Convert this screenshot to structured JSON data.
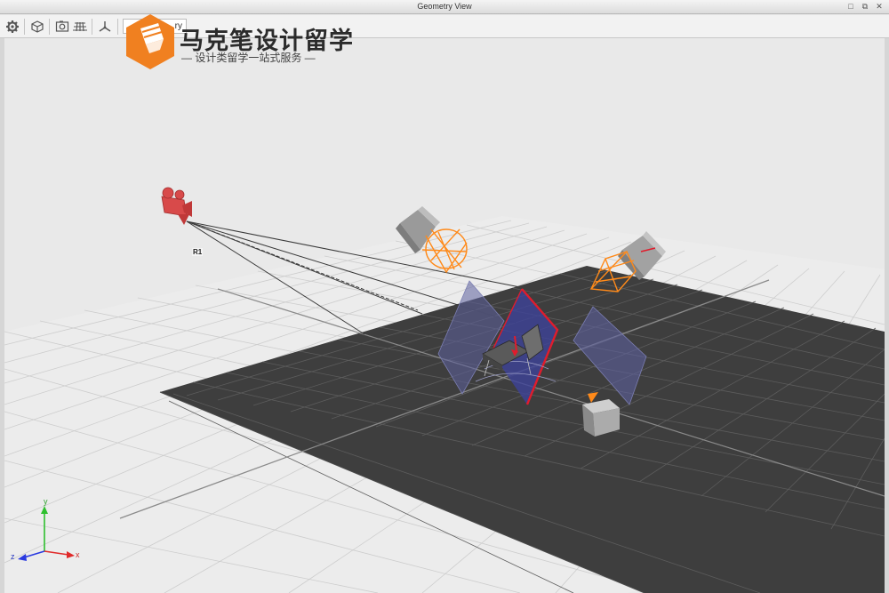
{
  "window": {
    "title": "Geometry View",
    "buttons": [
      "□",
      "⧉",
      "✕"
    ]
  },
  "toolbar": {
    "tools": [
      "settings-icon",
      "cube-icon",
      "screenshot-icon",
      "grid-icon",
      "axes-icon",
      "dropdown"
    ],
    "hidden_text": "ry"
  },
  "watermark": {
    "title": "马克笔设计留学",
    "subtitle": "— 设计类留学一站式服务 —",
    "brand_color": "#f08020"
  },
  "scene": {
    "camera_label": "R1",
    "axis_labels": {
      "x": "x",
      "y": "y",
      "z": "z"
    },
    "colors": {
      "floor": "#3d3d3d",
      "grid": "#cfcfcf",
      "camera": "#d84a4a",
      "wire": "#ff8a1a",
      "panel": "#4b4f9e",
      "highlight": "#e01c2c"
    }
  }
}
